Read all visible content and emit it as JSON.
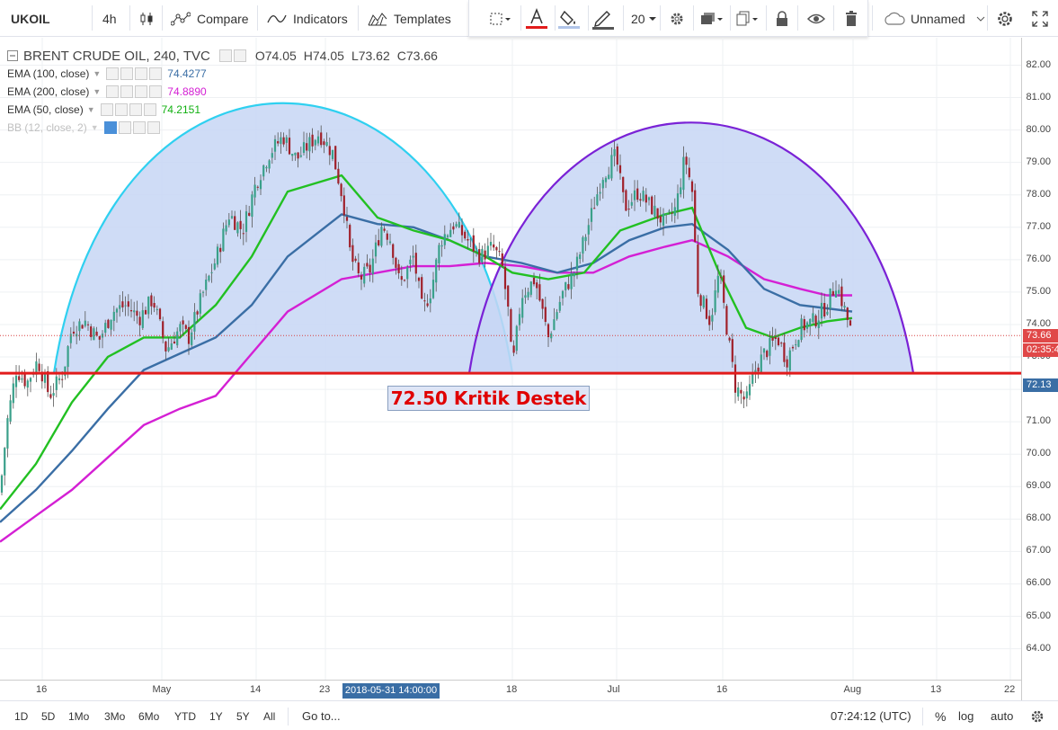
{
  "toolbar": {
    "symbol": "UKOIL",
    "interval": "4h",
    "compare": "Compare",
    "indicators": "Indicators",
    "templates": "Templates",
    "font_size": "20",
    "layout_name": "Unnamed"
  },
  "legend": {
    "title": "BRENT CRUDE OIL, 240, TVC",
    "open": "O74.05",
    "high": "H74.05",
    "low": "L73.62",
    "close": "C73.66",
    "studies": [
      {
        "label": "EMA (100, close)",
        "value": "74.4277",
        "color": "#3a6ea5"
      },
      {
        "label": "EMA (200, close)",
        "value": "74.8890",
        "color": "#d420d4"
      },
      {
        "label": "EMA (50, close)",
        "value": "74.2151",
        "color": "#22c022"
      },
      {
        "label": "BB (12, close, 2)",
        "value": "",
        "color": "#c0c0c0"
      }
    ]
  },
  "annotation": "72.50 Kritik Destek",
  "price_axis": [
    "82.00",
    "81.00",
    "80.00",
    "79.00",
    "78.00",
    "77.00",
    "76.00",
    "75.00",
    "74.00",
    "73.00",
    "72.00",
    "71.00",
    "70.00",
    "69.00",
    "68.00",
    "67.00",
    "66.00",
    "65.00",
    "64.00"
  ],
  "price_badges": {
    "last": "73.66",
    "countdown": "02:35:4",
    "support": "72.13"
  },
  "time_axis": [
    "16",
    "May",
    "14",
    "23",
    "18",
    "Jul",
    "16",
    "Aug",
    "13",
    "22"
  ],
  "crosshair_time": "2018-05-31 14:00:00",
  "bottombar": {
    "ranges": [
      "1D",
      "5D",
      "1Mo",
      "3Mo",
      "6Mo",
      "YTD",
      "1Y",
      "5Y",
      "All"
    ],
    "goto": "Go to...",
    "clock": "07:24:12 (UTC)",
    "percent": "%",
    "log": "log",
    "auto": "auto"
  },
  "colors": {
    "support_line": "#e21b1b",
    "arc_left": "#2fd0f0",
    "arc_right": "#7a22d6",
    "arc_fill": "#c7d6f5",
    "ema50": "#22c022",
    "ema100": "#3a6ea5",
    "ema200": "#d420d4",
    "up_candle": "#3aa08a",
    "down_candle": "#a0202a"
  },
  "chart_data": {
    "type": "candlestick",
    "support_level": 72.5,
    "last_price": 73.66,
    "ylim": [
      63.5,
      82.8
    ],
    "close_path": [
      [
        0,
        68.8
      ],
      [
        8,
        71
      ],
      [
        18,
        72.6
      ],
      [
        30,
        72.2
      ],
      [
        42,
        72.9
      ],
      [
        55,
        71.8
      ],
      [
        70,
        72.5
      ],
      [
        80,
        73.9
      ],
      [
        95,
        74.1
      ],
      [
        110,
        73.5
      ],
      [
        125,
        74.4
      ],
      [
        140,
        74.6
      ],
      [
        155,
        74.2
      ],
      [
        170,
        74.8
      ],
      [
        185,
        73.2
      ],
      [
        200,
        73.9
      ],
      [
        210,
        73.6
      ],
      [
        225,
        74.9
      ],
      [
        240,
        76
      ],
      [
        255,
        77.4
      ],
      [
        270,
        76.9
      ],
      [
        285,
        78.4
      ],
      [
        300,
        79.3
      ],
      [
        315,
        79.8
      ],
      [
        330,
        79.1
      ],
      [
        345,
        79.6
      ],
      [
        355,
        79.9
      ],
      [
        370,
        79.3
      ],
      [
        382,
        77.8
      ],
      [
        390,
        76.1
      ],
      [
        400,
        75.4
      ],
      [
        412,
        75.7
      ],
      [
        425,
        77.1
      ],
      [
        435,
        76.6
      ],
      [
        445,
        75.2
      ],
      [
        460,
        76.1
      ],
      [
        470,
        74.4
      ],
      [
        480,
        75.1
      ],
      [
        490,
        76.6
      ],
      [
        505,
        77.1
      ],
      [
        520,
        76.6
      ],
      [
        535,
        76.1
      ],
      [
        548,
        76.4
      ],
      [
        558,
        75.9
      ],
      [
        565,
        74.5
      ],
      [
        570,
        72.6
      ],
      [
        580,
        74.9
      ],
      [
        595,
        75.4
      ],
      [
        610,
        73.6
      ],
      [
        625,
        74.9
      ],
      [
        640,
        75.7
      ],
      [
        655,
        77.1
      ],
      [
        670,
        78.6
      ],
      [
        685,
        79.2
      ],
      [
        695,
        77.6
      ],
      [
        710,
        78.1
      ],
      [
        725,
        77.6
      ],
      [
        740,
        77.1
      ],
      [
        752,
        77.6
      ],
      [
        762,
        79.2
      ],
      [
        770,
        78.1
      ],
      [
        776,
        75.1
      ],
      [
        790,
        74.1
      ],
      [
        800,
        75.6
      ],
      [
        810,
        73.6
      ],
      [
        818,
        72.1
      ],
      [
        830,
        71.6
      ],
      [
        840,
        72.6
      ],
      [
        850,
        73.1
      ],
      [
        865,
        73.6
      ],
      [
        875,
        72.9
      ],
      [
        890,
        73.9
      ],
      [
        905,
        74.1
      ],
      [
        920,
        74.6
      ],
      [
        930,
        75.3
      ],
      [
        938,
        74.6
      ],
      [
        948,
        73.66
      ]
    ],
    "ema50": [
      [
        0,
        68.3
      ],
      [
        40,
        69.7
      ],
      [
        80,
        71.6
      ],
      [
        120,
        73
      ],
      [
        160,
        73.6
      ],
      [
        200,
        73.6
      ],
      [
        240,
        74.6
      ],
      [
        280,
        76.1
      ],
      [
        320,
        78.1
      ],
      [
        380,
        78.6
      ],
      [
        420,
        77.3
      ],
      [
        460,
        76.9
      ],
      [
        500,
        76.6
      ],
      [
        540,
        76.1
      ],
      [
        570,
        75.6
      ],
      [
        610,
        75.4
      ],
      [
        650,
        75.6
      ],
      [
        690,
        76.9
      ],
      [
        740,
        77.4
      ],
      [
        770,
        77.6
      ],
      [
        800,
        75.6
      ],
      [
        830,
        73.9
      ],
      [
        860,
        73.6
      ],
      [
        890,
        73.9
      ],
      [
        920,
        74.1
      ],
      [
        948,
        74.2
      ]
    ],
    "ema100": [
      [
        0,
        67.9
      ],
      [
        40,
        68.9
      ],
      [
        80,
        70.1
      ],
      [
        120,
        71.4
      ],
      [
        160,
        72.6
      ],
      [
        200,
        73.1
      ],
      [
        240,
        73.6
      ],
      [
        280,
        74.6
      ],
      [
        320,
        76.1
      ],
      [
        380,
        77.4
      ],
      [
        420,
        77.1
      ],
      [
        460,
        77
      ],
      [
        500,
        76.6
      ],
      [
        540,
        76.1
      ],
      [
        580,
        75.9
      ],
      [
        620,
        75.6
      ],
      [
        660,
        75.9
      ],
      [
        700,
        76.6
      ],
      [
        740,
        77
      ],
      [
        770,
        77.1
      ],
      [
        810,
        76.3
      ],
      [
        850,
        75.1
      ],
      [
        890,
        74.6
      ],
      [
        920,
        74.5
      ],
      [
        948,
        74.4
      ]
    ],
    "ema200": [
      [
        0,
        67.3
      ],
      [
        40,
        68.1
      ],
      [
        80,
        68.9
      ],
      [
        120,
        69.9
      ],
      [
        160,
        70.9
      ],
      [
        200,
        71.4
      ],
      [
        240,
        71.8
      ],
      [
        280,
        73.1
      ],
      [
        320,
        74.4
      ],
      [
        380,
        75.4
      ],
      [
        420,
        75.6
      ],
      [
        460,
        75.8
      ],
      [
        500,
        75.8
      ],
      [
        540,
        75.9
      ],
      [
        580,
        75.8
      ],
      [
        620,
        75.6
      ],
      [
        660,
        75.6
      ],
      [
        700,
        76.1
      ],
      [
        740,
        76.4
      ],
      [
        770,
        76.6
      ],
      [
        810,
        76.1
      ],
      [
        850,
        75.4
      ],
      [
        890,
        75.1
      ],
      [
        920,
        74.9
      ],
      [
        948,
        74.9
      ]
    ]
  }
}
